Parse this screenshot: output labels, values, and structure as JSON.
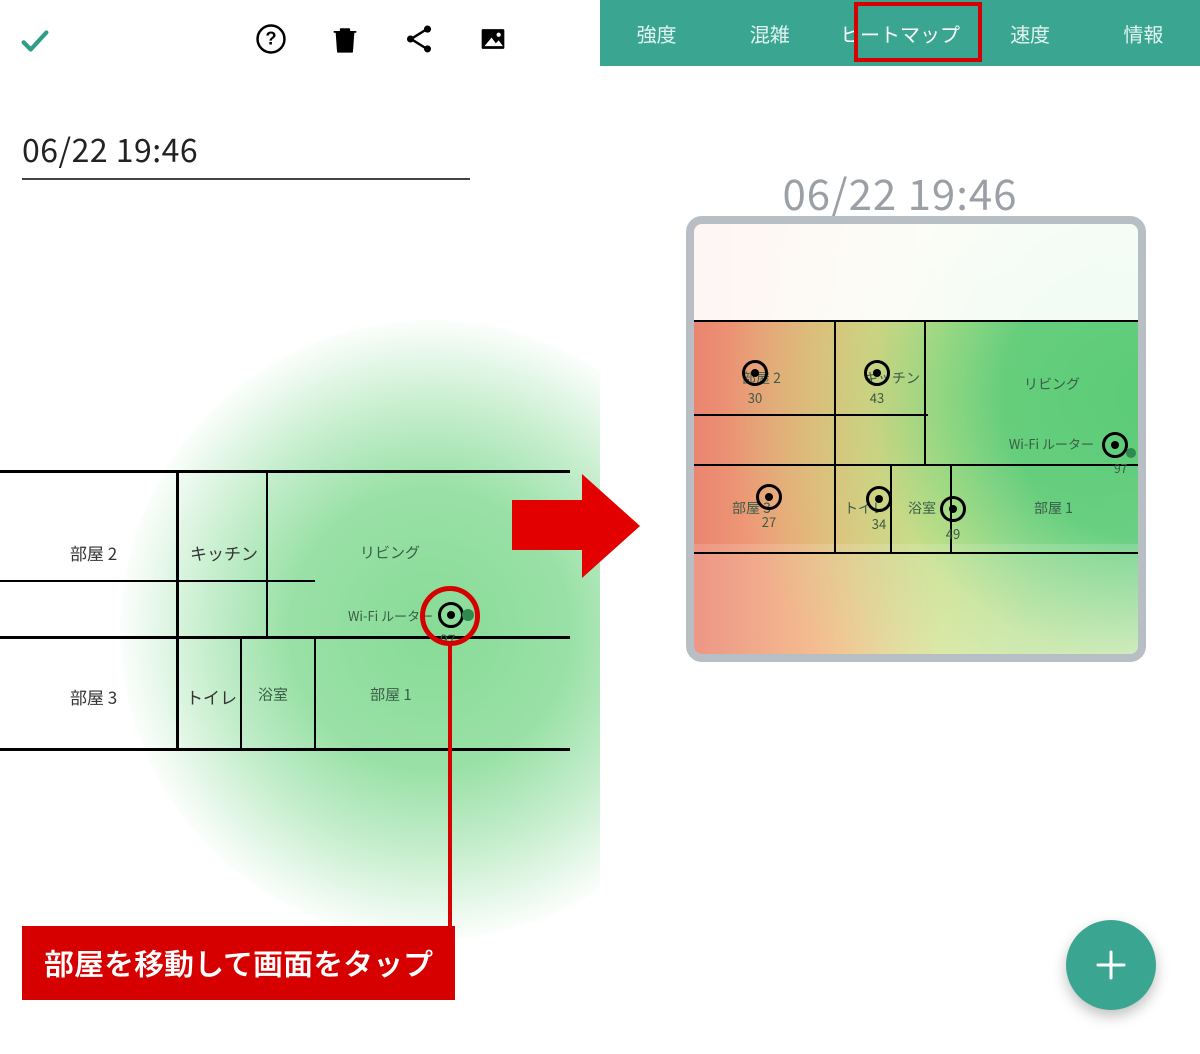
{
  "left": {
    "title": "06/22 19:46",
    "toolbar": {
      "check": "check-icon",
      "help": "help-icon",
      "delete": "trash-icon",
      "share": "share-icon",
      "image": "image-icon"
    },
    "rooms": {
      "room2": "部屋 2",
      "kitchen": "キッチン",
      "living": "リビング",
      "room3": "部屋 3",
      "toilet": "トイレ",
      "bath": "浴室",
      "room1": "部屋 1"
    },
    "router": {
      "label": "Wi-Fi ルーター",
      "value": "97"
    },
    "callout_text": "部屋を移動して画面をタップ"
  },
  "right": {
    "tabs": [
      "強度",
      "混雑",
      "ヒートマップ",
      "速度",
      "情報"
    ],
    "active_tab_index": 2,
    "title": "06/22 19:46",
    "rooms": {
      "room2": "部屋 2",
      "kitchen": "キッチン",
      "living": "リビング",
      "room3": "部屋 3",
      "toilet": "トイレ",
      "bath": "浴室",
      "room1": "部屋 1"
    },
    "router": {
      "label": "Wi-Fi ルーター",
      "value": "97"
    },
    "points": {
      "room2": "30",
      "kitchen": "43",
      "room3": "27",
      "toilet": "34",
      "bath": "49"
    },
    "fab": "plus-icon"
  },
  "colors": {
    "accent": "#3aa692",
    "highlight": "#d60000"
  }
}
